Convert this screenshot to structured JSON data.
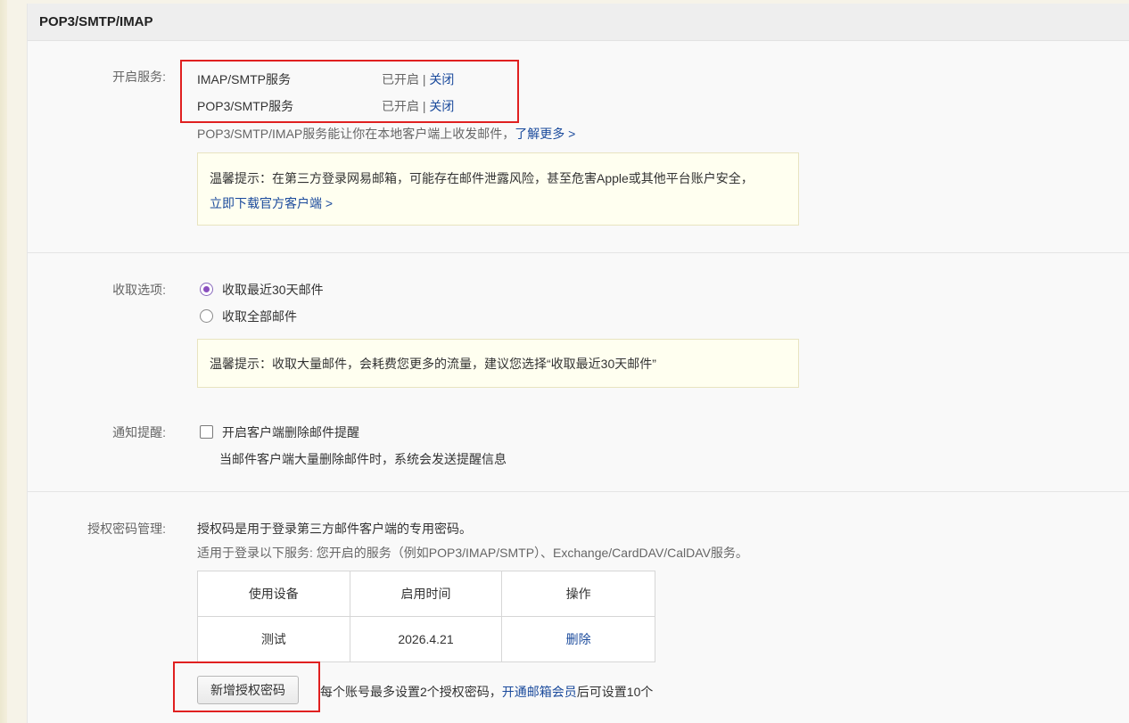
{
  "header": {
    "title": "POP3/SMTP/IMAP"
  },
  "services": {
    "label": "开启服务:",
    "items": [
      {
        "name": "IMAP/SMTP服务",
        "status": "已开启",
        "separator": "|",
        "action": "关闭"
      },
      {
        "name": "POP3/SMTP服务",
        "status": "已开启",
        "separator": "|",
        "action": "关闭"
      }
    ],
    "description": "POP3/SMTP/IMAP服务能让你在本地客户端上收发邮件，",
    "learn_more": "了解更多 >",
    "tip_text": "温馨提示：在第三方登录网易邮箱，可能存在邮件泄露风险，甚至危害Apple或其他平台账户安全，",
    "tip_link": "立即下载官方客户端 >"
  },
  "fetch": {
    "label": "收取选项:",
    "options": [
      {
        "label": "收取最近30天邮件",
        "selected": true
      },
      {
        "label": "收取全部邮件",
        "selected": false
      }
    ],
    "tip_text": "温馨提示：收取大量邮件，会耗费您更多的流量，建议您选择“收取最近30天邮件”"
  },
  "notify": {
    "label": "通知提醒:",
    "checkbox_label": "开启客户端删除邮件提醒",
    "checked": false,
    "description": "当邮件客户端大量删除邮件时，系统会发送提醒信息"
  },
  "auth": {
    "label": "授权密码管理:",
    "line1": "授权码是用于登录第三方邮件客户端的专用密码。",
    "line2": "适用于登录以下服务: 您开启的服务（例如POP3/IMAP/SMTP）、Exchange/CardDAV/CalDAV服务。",
    "columns": [
      "使用设备",
      "启用时间",
      "操作"
    ],
    "rows": [
      {
        "device": "测试",
        "time": "2026.4.21",
        "action": "删除"
      }
    ],
    "add_button": "新增授权密码",
    "note_prefix": "每个账号最多设置2个授权密码，",
    "note_link": "开通邮箱会员",
    "note_suffix": "后可设置10个"
  },
  "colors": {
    "link": "#1a4a9c",
    "highlight_box": "#e02020",
    "tip_bg": "#fffff0",
    "radio_accent": "#8a4fbf"
  }
}
